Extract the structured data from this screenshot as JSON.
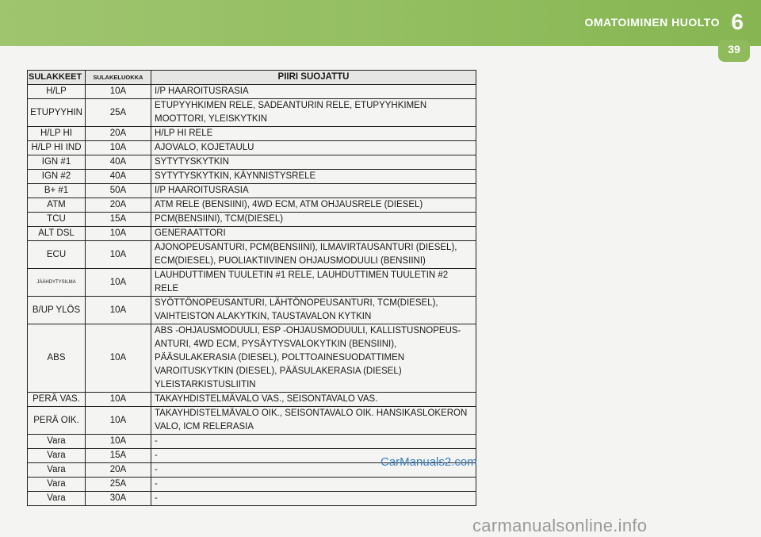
{
  "header": {
    "section_title": "OMATOIMINEN HUOLTO",
    "chapter_number": "6",
    "page_number": "39"
  },
  "table": {
    "columns": [
      "SULAKKEET",
      "SULAKELUOKKA",
      "PIIRI SUOJATTU"
    ],
    "rows": [
      [
        "H/LP",
        "10A",
        "I/P HAAROITUSRASIA"
      ],
      [
        "ETUPYYHIN",
        "25A",
        "ETUPYYHKIMEN RELE, SADEANTURIN RELE, ETUPYYHKIMEN MOOTTORI, YLEISKYTKIN"
      ],
      [
        "H/LP HI",
        "20A",
        "H/LP HI RELE"
      ],
      [
        "H/LP HI IND",
        "10A",
        "AJOVALO, KOJETAULU"
      ],
      [
        "IGN #1",
        "40A",
        "SYTYTYSKYTKIN"
      ],
      [
        "IGN #2",
        "40A",
        "SYTYTYSKYTKIN, KÄYNNISTYSRELE"
      ],
      [
        "B+ #1",
        "50A",
        "I/P HAAROITUSRASIA"
      ],
      [
        "ATM",
        "20A",
        "ATM RELE (BENSIINI), 4WD ECM, ATM OHJAUSRELE (DIESEL)"
      ],
      [
        "TCU",
        "15A",
        "PCM(BENSIINI), TCM(DIESEL)"
      ],
      [
        "ALT DSL",
        "10A",
        "GENERAATTORI"
      ],
      [
        "ECU",
        "10A",
        "AJONOPEUSANTURI, PCM(BENSIINI), ILMAVIRTAUSANTURI (DIESEL), ECM(DIESEL), PUOLIAKTIIVINEN OHJAUSMODUULI (BENSIINI)"
      ],
      [
        "JÄÄHDYTYSILMA",
        "10A",
        "LAUHDUTTIMEN TUULETIN #1 RELE, LAUHDUTTIMEN TUULETIN #2 RELE"
      ],
      [
        "B/UP YLÖS",
        "10A",
        "SYÖTTÖNOPEUSANTURI, LÄHTÖNOPEUSANTURI, TCM(DIESEL), VAIHTEISTON ALAKYTKIN, TAUSTAVALON KYTKIN"
      ],
      [
        "ABS",
        "10A",
        "ABS -OHJAUSMODUULI, ESP -OHJAUSMODUULI, KALLISTUSNOPEUS-ANTURI, 4WD ECM, PYSÄYTYSVALOKYTKIN (BENSIINI), PÄÄSULAKERASIA (DIESEL), POLTTOAINESUODATTIMEN VAROITUSKYTKIN (DIESEL), PÄÄSULAKERASIA (DIESEL) YLEISTARKISTUSLIITIN"
      ],
      [
        "PERÄ VAS.",
        "10A",
        "TAKAYHDISTELMÄVALO VAS., SEISONTAVALO VAS."
      ],
      [
        "PERÄ OIK.",
        "10A",
        "TAKAYHDISTELMÄVALO OIK., SEISONTAVALO OIK. HANSIKASLOKERON VALO, ICM RELERASIA"
      ],
      [
        "Vara",
        "10A",
        "-"
      ],
      [
        "Vara",
        "15A",
        "-"
      ],
      [
        "Vara",
        "20A",
        "-"
      ],
      [
        "Vara",
        "25A",
        "-"
      ],
      [
        "Vara",
        "30A",
        "-"
      ]
    ]
  },
  "watermark": "CarManuals2.com",
  "footer": "carmanualsonline.info"
}
